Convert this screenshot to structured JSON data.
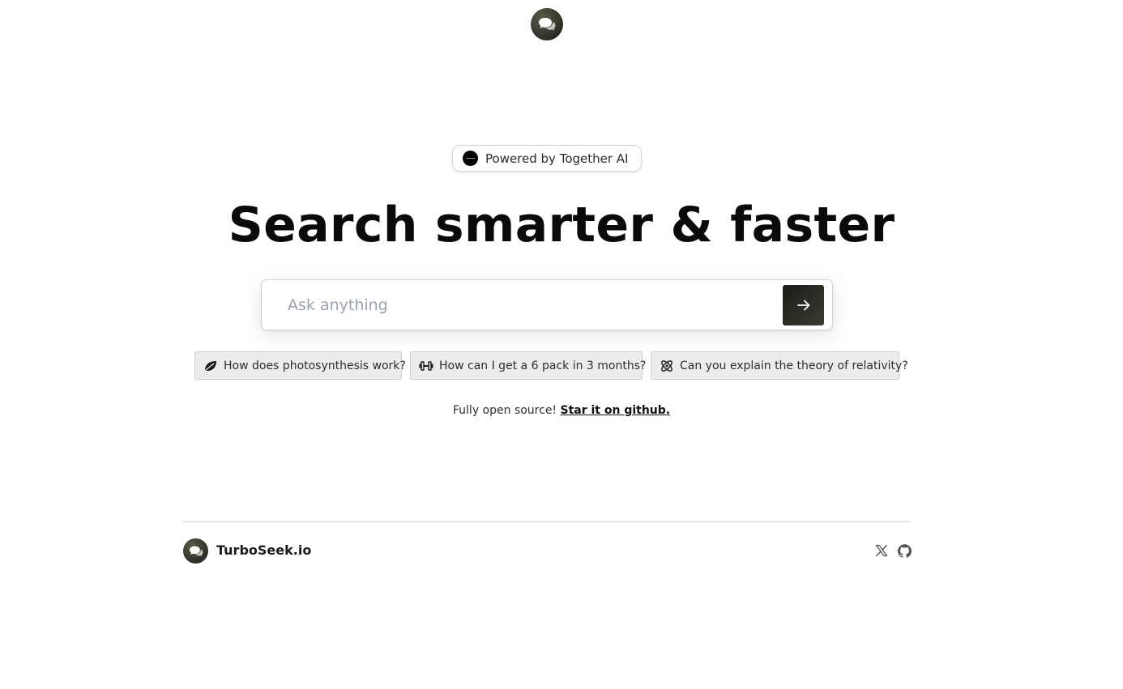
{
  "header": {
    "logo_icon": "chat-bubble-icon"
  },
  "badge": {
    "text": "Powered by Together AI",
    "icon": "together-ai-icon"
  },
  "hero": {
    "headline": "Search smarter & faster"
  },
  "search": {
    "placeholder": "Ask anything",
    "value": "",
    "submit_icon": "arrow-right-icon"
  },
  "suggestions": [
    {
      "icon": "leaf-icon",
      "label": "How does photosynthesis work?"
    },
    {
      "icon": "dumbbell-icon",
      "label": "How can I get a 6 pack in 3 months?"
    },
    {
      "icon": "atom-icon",
      "label": "Can you explain the theory of relativity?"
    }
  ],
  "open_source": {
    "text": "Fully open source!",
    "link_label": "Star it on github."
  },
  "footer": {
    "brand": "TurboSeek.io",
    "social_icons": [
      "x-icon",
      "github-icon"
    ]
  },
  "colors": {
    "accent": "#2d2d25",
    "chip_background": "#ececec",
    "background": "#ffffff"
  }
}
